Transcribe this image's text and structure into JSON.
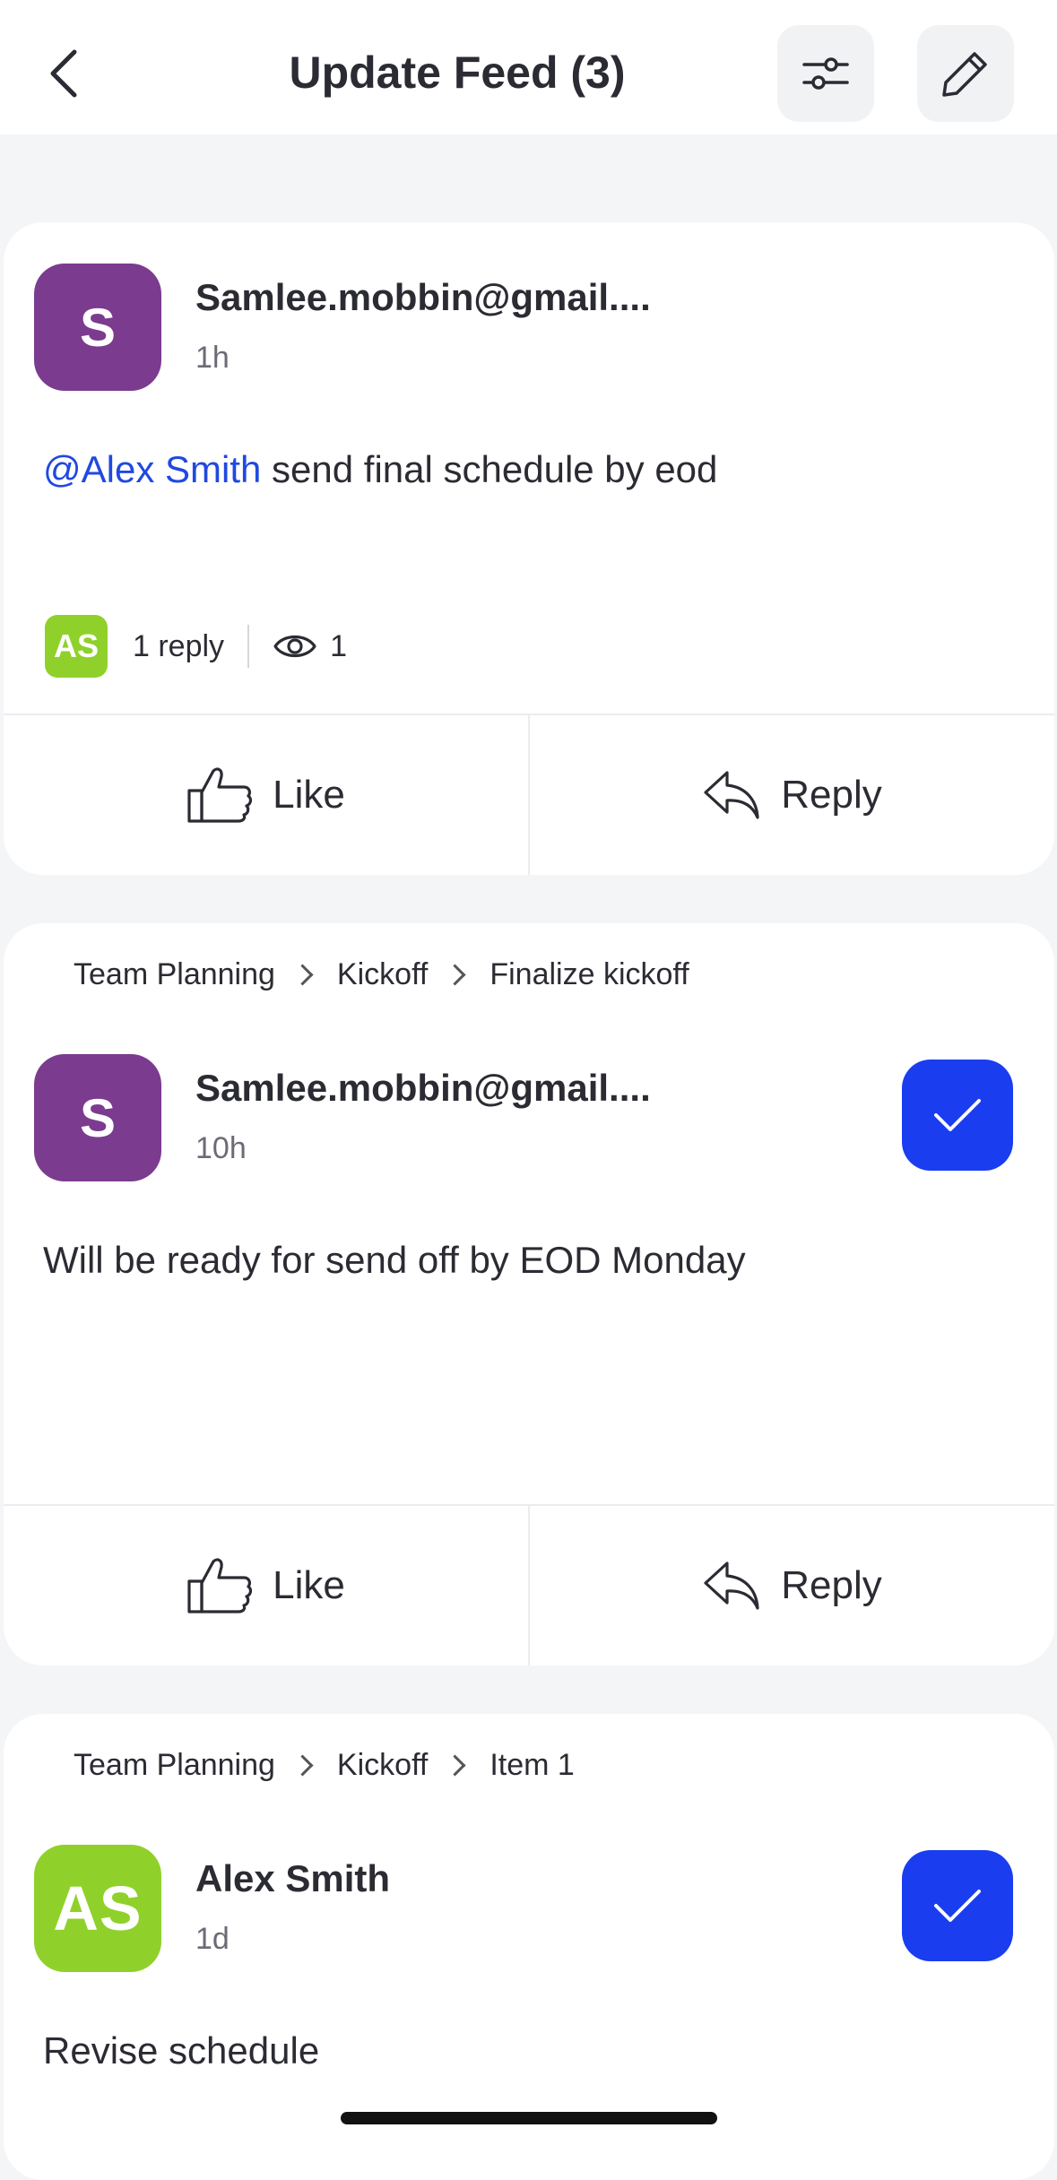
{
  "header": {
    "title": "Update Feed (3)"
  },
  "feed": [
    {
      "author": "Samlee.mobbin@gmail....",
      "avatar_initials": "S",
      "avatar_color": "#7b3b8e",
      "time": "1h",
      "mention": "@Alex Smith",
      "message": " send final schedule by eod",
      "reply_avatar_initials": "AS",
      "reply_count": "1 reply",
      "views": "1",
      "like_label": "Like",
      "reply_label": "Reply"
    },
    {
      "breadcrumb": [
        "Team Planning",
        "Kickoff",
        "Finalize kickoff"
      ],
      "author": "Samlee.mobbin@gmail....",
      "avatar_initials": "S",
      "avatar_color": "#7b3b8e",
      "time": "10h",
      "message": "Will be ready for send off by EOD Monday",
      "like_label": "Like",
      "reply_label": "Reply"
    },
    {
      "breadcrumb": [
        "Team Planning",
        "Kickoff",
        "Item 1"
      ],
      "author": "Alex Smith",
      "avatar_initials": "AS",
      "avatar_color": "#8fd12a",
      "time": "1d",
      "message": "Revise schedule"
    }
  ],
  "colors": {
    "accent_blue": "#1a3df0",
    "mention_blue": "#2148e0"
  },
  "icons": {
    "back": "chevron-left-icon",
    "filter": "sliders-icon",
    "edit": "pencil-icon",
    "views": "eye-icon",
    "like": "thumbs-up-icon",
    "reply": "reply-arrow-icon",
    "check": "checkmark-icon"
  }
}
